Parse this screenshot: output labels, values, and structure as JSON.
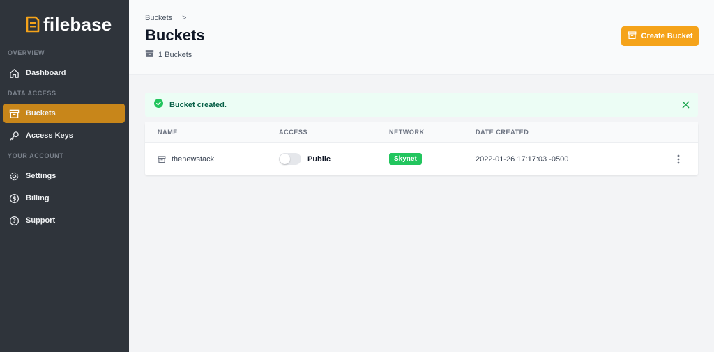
{
  "app": {
    "name": "filebase"
  },
  "colors": {
    "accent": "#f5a31a",
    "active_nav": "#c8861a",
    "sidebar_bg": "#2f343b",
    "success": "#22c55e"
  },
  "sidebar": {
    "sections": {
      "overview": "OVERVIEW",
      "data_access": "DATA ACCESS",
      "your_account": "YOUR ACCOUNT"
    },
    "items": [
      {
        "label": "Dashboard",
        "icon": "home-icon"
      },
      {
        "label": "Buckets",
        "icon": "archive-icon",
        "active": true
      },
      {
        "label": "Access Keys",
        "icon": "key-icon"
      },
      {
        "label": "Settings",
        "icon": "gear-icon"
      },
      {
        "label": "Billing",
        "icon": "dollar-circle-icon"
      },
      {
        "label": "Support",
        "icon": "question-circle-icon"
      }
    ]
  },
  "header": {
    "breadcrumb": "Buckets",
    "breadcrumb_separator": ">",
    "title": "Buckets",
    "count": "1 Buckets",
    "create_button": "Create Bucket"
  },
  "alert": {
    "message": "Bucket created."
  },
  "table": {
    "columns": [
      "NAME",
      "ACCESS",
      "NETWORK",
      "DATE CREATED"
    ],
    "rows": [
      {
        "name": "thenewstack",
        "access": "Public",
        "access_enabled": false,
        "network": "Skynet",
        "date_created": "2022-01-26 17:17:03 -0500"
      }
    ]
  }
}
